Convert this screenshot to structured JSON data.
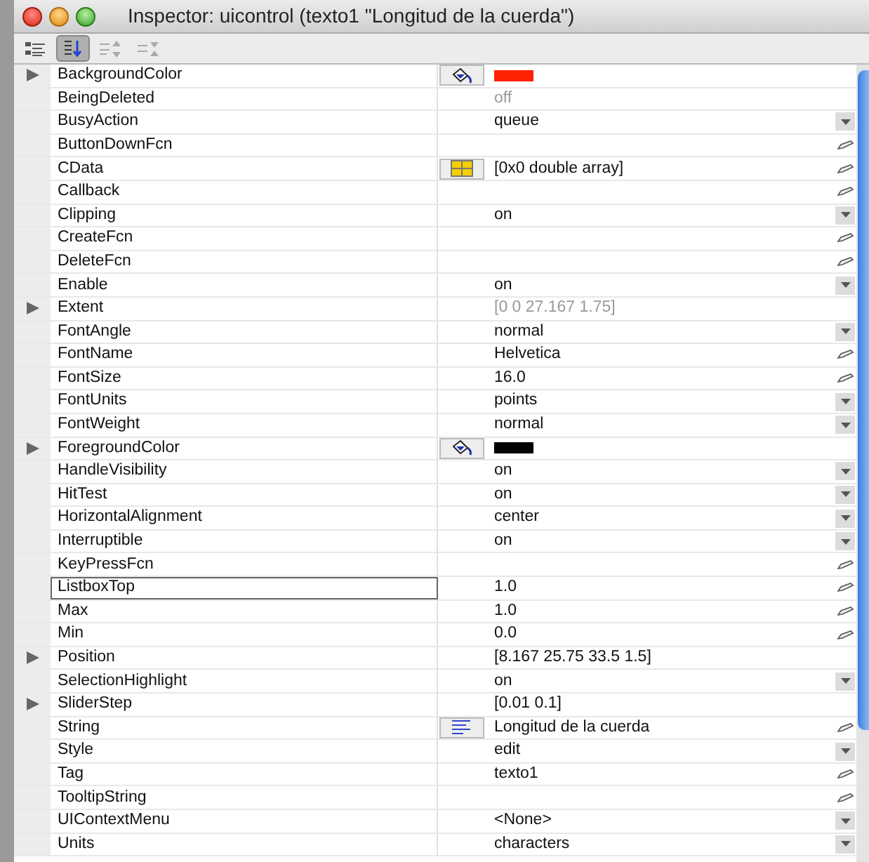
{
  "window": {
    "title": "Inspector:  uicontrol (texto1 \"Longitud de la cuerda\")"
  },
  "toolbar": [
    {
      "kind": "categorized",
      "selected": false
    },
    {
      "kind": "sorted",
      "selected": true
    },
    {
      "kind": "expand",
      "selected": false
    },
    {
      "kind": "collapse",
      "selected": false
    }
  ],
  "properties": [
    {
      "name": "BackgroundColor",
      "expandable": true,
      "editor": {
        "kind": "color"
      },
      "color": "#ff2200"
    },
    {
      "name": "BeingDeleted",
      "value": "off",
      "disabled": true
    },
    {
      "name": "BusyAction",
      "value": "queue",
      "action": {
        "kind": "dropdown"
      }
    },
    {
      "name": "ButtonDownFcn",
      "action": {
        "kind": "edit"
      }
    },
    {
      "name": "CData",
      "editor": {
        "kind": "table"
      },
      "value": "[0x0  double array]",
      "action": {
        "kind": "edit"
      }
    },
    {
      "name": "Callback",
      "action": {
        "kind": "edit"
      }
    },
    {
      "name": "Clipping",
      "value": "on",
      "action": {
        "kind": "dropdown"
      }
    },
    {
      "name": "CreateFcn",
      "action": {
        "kind": "edit"
      }
    },
    {
      "name": "DeleteFcn",
      "action": {
        "kind": "edit"
      }
    },
    {
      "name": "Enable",
      "value": "on",
      "action": {
        "kind": "dropdown"
      }
    },
    {
      "name": "Extent",
      "expandable": true,
      "value": "[0 0 27.167 1.75]",
      "disabled": true
    },
    {
      "name": "FontAngle",
      "value": "normal",
      "action": {
        "kind": "dropdown"
      }
    },
    {
      "name": "FontName",
      "value": "Helvetica",
      "action": {
        "kind": "edit"
      }
    },
    {
      "name": "FontSize",
      "value": "16.0",
      "action": {
        "kind": "edit"
      }
    },
    {
      "name": "FontUnits",
      "value": "points",
      "action": {
        "kind": "dropdown"
      }
    },
    {
      "name": "FontWeight",
      "value": "normal",
      "action": {
        "kind": "dropdown"
      }
    },
    {
      "name": "ForegroundColor",
      "expandable": true,
      "editor": {
        "kind": "color"
      },
      "color": "#000000"
    },
    {
      "name": "HandleVisibility",
      "value": "on",
      "action": {
        "kind": "dropdown"
      }
    },
    {
      "name": "HitTest",
      "value": "on",
      "action": {
        "kind": "dropdown"
      }
    },
    {
      "name": "HorizontalAlignment",
      "value": "center",
      "action": {
        "kind": "dropdown"
      }
    },
    {
      "name": "Interruptible",
      "value": "on",
      "action": {
        "kind": "dropdown"
      }
    },
    {
      "name": "KeyPressFcn",
      "action": {
        "kind": "edit"
      }
    },
    {
      "name": "ListboxTop",
      "value": "1.0",
      "action": {
        "kind": "edit"
      },
      "selected": true
    },
    {
      "name": "Max",
      "value": "1.0",
      "action": {
        "kind": "edit"
      }
    },
    {
      "name": "Min",
      "value": "0.0",
      "action": {
        "kind": "edit"
      }
    },
    {
      "name": "Position",
      "expandable": true,
      "value": "[8.167 25.75 33.5 1.5]"
    },
    {
      "name": "SelectionHighlight",
      "value": "on",
      "action": {
        "kind": "dropdown"
      }
    },
    {
      "name": "SliderStep",
      "expandable": true,
      "value": "[0.01 0.1]"
    },
    {
      "name": "String",
      "editor": {
        "kind": "text"
      },
      "value": "Longitud de la cuerda",
      "action": {
        "kind": "edit"
      }
    },
    {
      "name": "Style",
      "value": "edit",
      "action": {
        "kind": "dropdown"
      }
    },
    {
      "name": "Tag",
      "value": "texto1",
      "action": {
        "kind": "edit"
      }
    },
    {
      "name": "TooltipString",
      "action": {
        "kind": "edit"
      }
    },
    {
      "name": "UIContextMenu",
      "value": "<None>",
      "action": {
        "kind": "dropdown"
      }
    },
    {
      "name": "Units",
      "value": "characters",
      "action": {
        "kind": "dropdown"
      }
    }
  ]
}
